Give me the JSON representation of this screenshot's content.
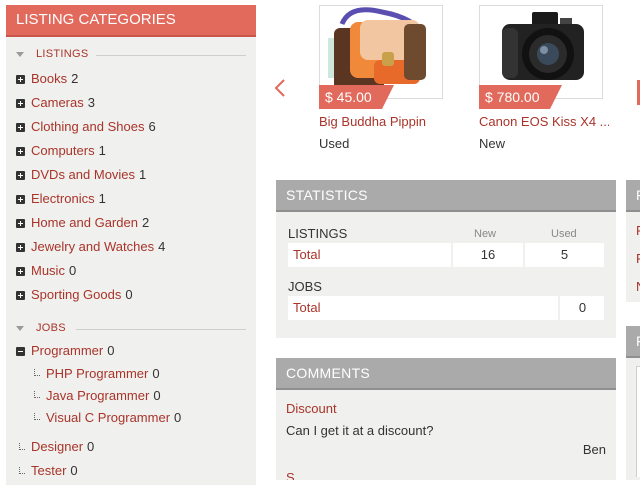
{
  "sidebar": {
    "title": "LISTING CATEGORIES",
    "listings_heading": "LISTINGS",
    "categories": [
      {
        "label": "Books",
        "count": "2"
      },
      {
        "label": "Cameras",
        "count": "3"
      },
      {
        "label": "Clothing and Shoes",
        "count": "6"
      },
      {
        "label": "Computers",
        "count": "1"
      },
      {
        "label": "DVDs and Movies",
        "count": "1"
      },
      {
        "label": "Electronics",
        "count": "1"
      },
      {
        "label": "Home and Garden",
        "count": "2"
      },
      {
        "label": "Jewelry and Watches",
        "count": "4"
      },
      {
        "label": "Music",
        "count": "0"
      },
      {
        "label": "Sporting Goods",
        "count": "0"
      }
    ],
    "jobs_heading": "JOBS",
    "jobs": {
      "programmer": {
        "label": "Programmer",
        "count": "0"
      },
      "sub": [
        {
          "label": "PHP Programmer",
          "count": "0"
        },
        {
          "label": "Java Programmer",
          "count": "0"
        },
        {
          "label": "Visual C Programmer",
          "count": "0"
        }
      ],
      "designer": {
        "label": "Designer",
        "count": "0"
      },
      "tester": {
        "label": "Tester",
        "count": "0"
      }
    }
  },
  "carousel": {
    "prev_icon": "chevron-left-icon",
    "products": [
      {
        "price": "$ 45.00",
        "title": "Big Buddha Pippin",
        "condition": "Used",
        "image": "handbag-image"
      },
      {
        "price": "$ 780.00",
        "title": "Canon EOS Kiss X4 ...",
        "condition": "New",
        "image": "camera-image"
      }
    ]
  },
  "statistics": {
    "title": "STATISTICS",
    "listings": {
      "label": "LISTINGS",
      "col_new": "New",
      "col_used": "Used",
      "row_label": "Total",
      "new": "16",
      "used": "5"
    },
    "jobs": {
      "label": "JOBS",
      "row_label": "Total",
      "count": "0"
    }
  },
  "comments": {
    "title": "COMMENTS",
    "items": [
      {
        "title": "Discount",
        "body": "Can I get it at a discount?",
        "author": "Ben"
      }
    ],
    "next_partial": "S"
  },
  "right_panel_a": {
    "title_partial": "F",
    "lines": [
      "F",
      "F",
      "N"
    ]
  },
  "right_panel_b": {
    "title_partial": "F"
  },
  "colors": {
    "accent": "#e16a5c",
    "link": "#a9342a",
    "panel_bg": "#f0f0ee",
    "panel_header": "#aaaaaa"
  }
}
